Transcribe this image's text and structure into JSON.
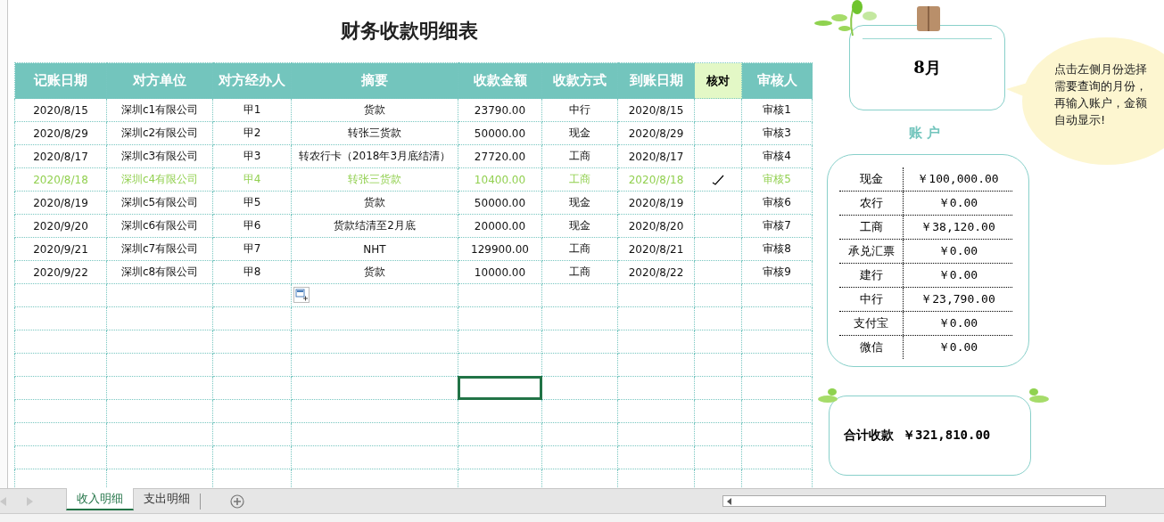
{
  "title": "财务收款明细表",
  "columns": [
    {
      "label": "记账日期",
      "kind": "normal"
    },
    {
      "label": "对方单位",
      "kind": "normal"
    },
    {
      "label": "对方经办人",
      "kind": "normal"
    },
    {
      "label": "摘要",
      "kind": "normal"
    },
    {
      "label": "收款金额",
      "kind": "normal"
    },
    {
      "label": "收款方式",
      "kind": "normal"
    },
    {
      "label": "到账日期",
      "kind": "normal"
    },
    {
      "label": "核对",
      "kind": "check"
    },
    {
      "label": "审核人",
      "kind": "normal"
    }
  ],
  "rows": [
    {
      "cells": [
        "2020/8/15",
        "深圳c1有限公司",
        "甲1",
        "货款",
        "23790.00",
        "中行",
        "2020/8/15",
        "审核1"
      ],
      "checked": false
    },
    {
      "cells": [
        "2020/8/29",
        "深圳c2有限公司",
        "甲2",
        "转张三货款",
        "50000.00",
        "现金",
        "2020/8/29",
        "审核3"
      ],
      "checked": false
    },
    {
      "cells": [
        "2020/8/17",
        "深圳c3有限公司",
        "甲3",
        "转农行卡（2018年3月底结清）",
        "27720.00",
        "工商",
        "2020/8/17",
        "审核4"
      ],
      "checked": false
    },
    {
      "cells": [
        "2020/8/18",
        "深圳c4有限公司",
        "甲4",
        "转张三货款",
        "10400.00",
        "工商",
        "2020/8/18",
        "审核5"
      ],
      "checked": true
    },
    {
      "cells": [
        "2020/8/19",
        "深圳c5有限公司",
        "甲5",
        "货款",
        "50000.00",
        "现金",
        "2020/8/19",
        "审核6"
      ],
      "checked": false
    },
    {
      "cells": [
        "2020/9/20",
        "深圳c6有限公司",
        "甲6",
        "货款结清至2月底",
        "20000.00",
        "现金",
        "2020/8/20",
        "审核7"
      ],
      "checked": false
    },
    {
      "cells": [
        "2020/9/21",
        "深圳c7有限公司",
        "甲7",
        "NHT",
        "129900.00",
        "工商",
        "2020/8/21",
        "审核8"
      ],
      "checked": false
    },
    {
      "cells": [
        "2020/9/22",
        "深圳c8有限公司",
        "甲8",
        "货款",
        "10000.00",
        "工商",
        "2020/8/22",
        "审核9"
      ],
      "checked": false
    }
  ],
  "blank_rows": [
    {
      "selected_cells": [
        false,
        false,
        false,
        false,
        false,
        false,
        false,
        false,
        false
      ]
    },
    {
      "selected_cells": [
        false,
        false,
        false,
        false,
        false,
        false,
        false,
        false,
        false
      ]
    },
    {
      "selected_cells": [
        false,
        false,
        false,
        false,
        false,
        false,
        false,
        false,
        false
      ]
    },
    {
      "selected_cells": [
        false,
        false,
        false,
        false,
        false,
        false,
        false,
        false,
        false
      ]
    },
    {
      "selected_cells": [
        false,
        false,
        false,
        false,
        true,
        false,
        false,
        false,
        false
      ]
    },
    {
      "selected_cells": [
        false,
        false,
        false,
        false,
        false,
        false,
        false,
        false,
        false
      ]
    },
    {
      "selected_cells": [
        false,
        false,
        false,
        false,
        false,
        false,
        false,
        false,
        false
      ]
    },
    {
      "selected_cells": [
        false,
        false,
        false,
        false,
        false,
        false,
        false,
        false,
        false
      ]
    },
    {
      "selected_cells": [
        false,
        false,
        false,
        false,
        false,
        false,
        false,
        false,
        false
      ]
    }
  ],
  "month": "8月",
  "hint": "点击左侧月份选择需要查询的月份，再输入账户，金额自动显示!",
  "accounts_title": "账 户",
  "accounts": [
    {
      "name": "现金",
      "amount": "￥100,000.00"
    },
    {
      "name": "农行",
      "amount": "￥0.00"
    },
    {
      "name": "工商",
      "amount": "￥38,120.00"
    },
    {
      "name": "承兑汇票",
      "amount": "￥0.00"
    },
    {
      "name": "建行",
      "amount": "￥0.00"
    },
    {
      "name": "中行",
      "amount": "￥23,790.00"
    },
    {
      "name": "支付宝",
      "amount": "￥0.00"
    },
    {
      "name": "微信",
      "amount": "￥0.00"
    }
  ],
  "total": {
    "label": "合计收款",
    "amount": "￥321,810.00"
  },
  "sheet_tabs": [
    {
      "label": "收入明细",
      "selected": true
    },
    {
      "label": "支出明细",
      "selected": false
    }
  ]
}
